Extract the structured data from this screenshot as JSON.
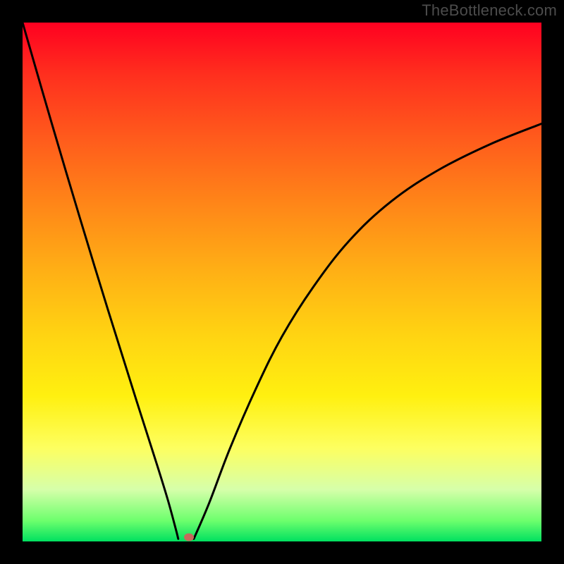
{
  "watermark": "TheBottleneck.com",
  "colors": {
    "page_bg": "#000000",
    "watermark": "#4c4c4c",
    "curve": "#000000",
    "marker": "#c56a5c",
    "gradient_stops": [
      "#ff0020",
      "#ff2f1e",
      "#ff5a1c",
      "#ff8618",
      "#ffb015",
      "#ffd312",
      "#fff010",
      "#fdff60",
      "#d6ffaa",
      "#6dff6d",
      "#00e060"
    ]
  },
  "chart_data": {
    "type": "line",
    "title": "",
    "xlabel": "",
    "ylabel": "",
    "xlim": [
      0,
      100
    ],
    "ylim": [
      0,
      100
    ],
    "grid": false,
    "legend": false,
    "description": "Two-branch V-shaped bottleneck curve on a vertical red→green gradient; minimum near x≈30 at y≈0. Left branch is steep and nearly linear; right branch rises with diminishing slope.",
    "series": [
      {
        "name": "left_branch",
        "x": [
          0.0,
          5.5,
          11.0,
          16.5,
          22.0,
          26.0,
          28.0,
          29.5,
          30.0
        ],
        "y": [
          100.0,
          81.0,
          62.5,
          44.5,
          27.0,
          14.5,
          8.0,
          2.5,
          0.5
        ]
      },
      {
        "name": "right_branch",
        "x": [
          33.0,
          36.0,
          40.0,
          45.0,
          50.0,
          56.0,
          63.0,
          71.0,
          80.0,
          90.0,
          100.0
        ],
        "y": [
          0.5,
          7.5,
          18.0,
          29.5,
          39.5,
          49.0,
          58.0,
          65.5,
          71.5,
          76.5,
          80.5
        ]
      }
    ],
    "marker": {
      "x": 32.0,
      "y": 0.8
    }
  }
}
